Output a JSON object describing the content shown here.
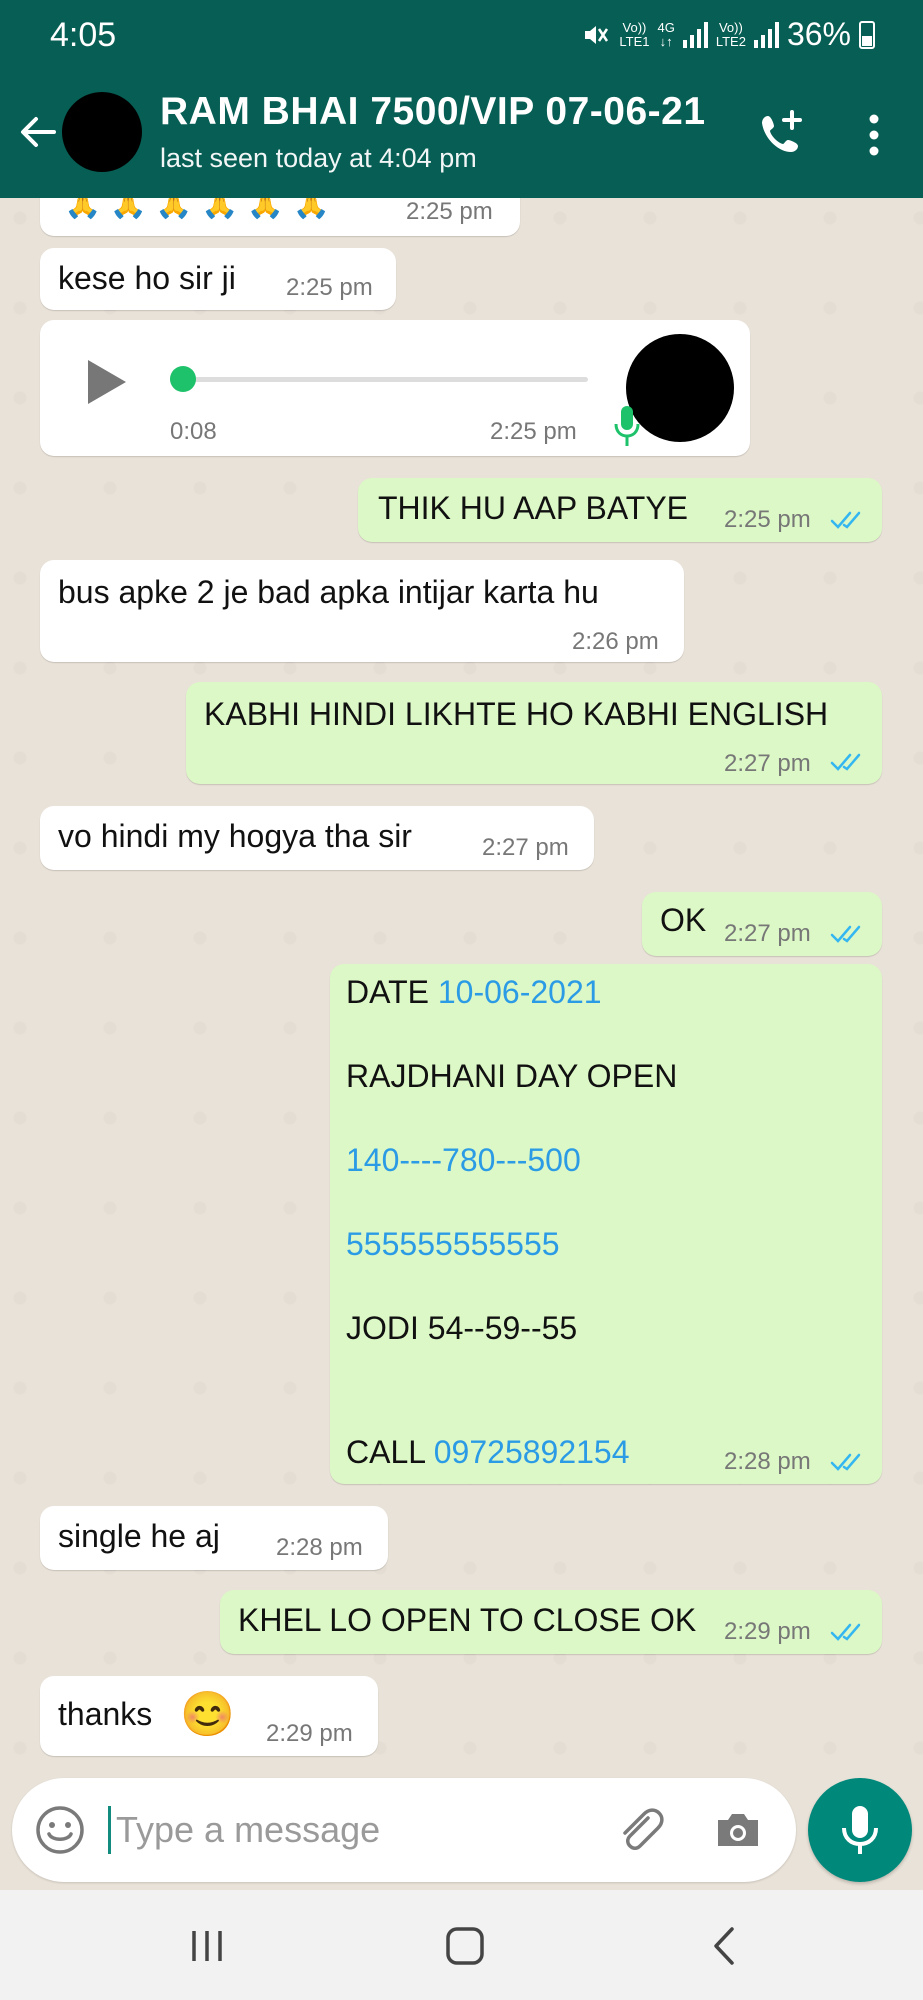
{
  "status_bar": {
    "time": "4:05",
    "sim1_top": "Vo))",
    "sim1_bottom": "LTE1",
    "net_top": "4G",
    "net_bottom": "↓↑",
    "sim2_top": "Vo))",
    "sim2_bottom": "LTE2",
    "battery": "36%"
  },
  "header": {
    "title": "RAM BHAI 7500/VIP 07-06-21",
    "subtitle": "last seen today at 4:04 pm"
  },
  "messages": {
    "m0": {
      "text": "🙏 🙏 🙏 🙏 🙏 🙏",
      "time": "2:25 pm"
    },
    "m1": {
      "text": "kese ho sir ji",
      "time": "2:25 pm"
    },
    "voice": {
      "duration": "0:08",
      "time": "2:25 pm",
      "progress": 0.0
    },
    "m2": {
      "text": "THIK HU AAP BATYE",
      "time": "2:25 pm"
    },
    "m3": {
      "text": "bus apke  2 je bad apka intijar karta hu",
      "time": "2:26 pm"
    },
    "m4": {
      "text": "KABHI HINDI LIKHTE HO KABHI ENGLISH",
      "time": "2:27 pm"
    },
    "m5": {
      "text": "vo hindi my hogya tha sir",
      "time": "2:27 pm"
    },
    "m6": {
      "text": "OK",
      "time": "2:27 pm"
    },
    "m7": {
      "date_label": "DATE",
      "date_value": "10-06-2021",
      "market": "RAJDHANI  DAY OPEN",
      "numbers": "140----780---500",
      "fives": "555555555555",
      "jodi": "JODI 54--59--55",
      "call_label": "CALL",
      "call_number": "09725892154",
      "time": "2:28 pm"
    },
    "m8": {
      "text": "single  he aj",
      "time": "2:28 pm"
    },
    "m9": {
      "text": "KHEL LO OPEN TO CLOSE OK",
      "time": "2:29 pm"
    },
    "m10": {
      "text": "thanks",
      "emoji": "😊",
      "time": "2:29 pm"
    }
  },
  "composer": {
    "placeholder": "Type a message",
    "value": ""
  },
  "colors": {
    "header": "#075e54",
    "outgoing": "#dcf8c6",
    "incoming": "#ffffff",
    "read_ticks": "#34b7f1",
    "link": "#2b9be5",
    "mic_button": "#00897b"
  }
}
